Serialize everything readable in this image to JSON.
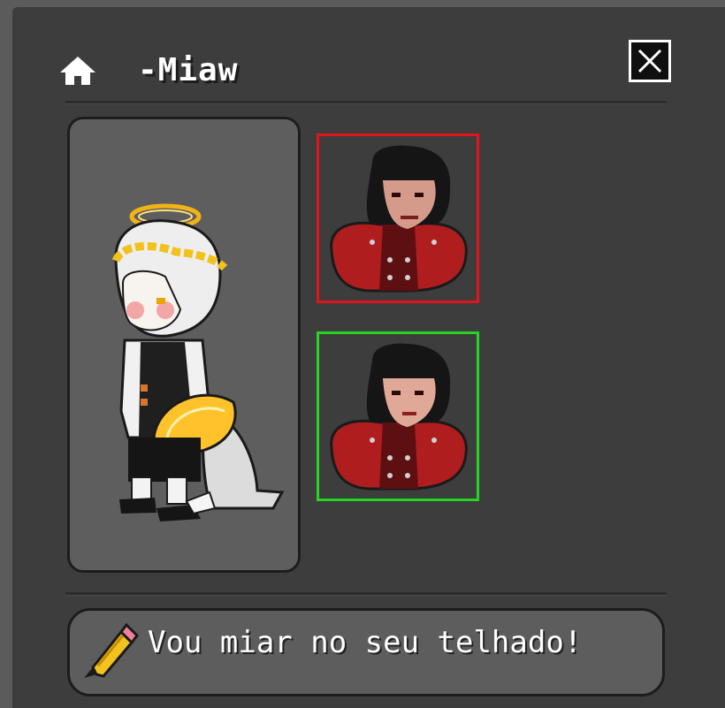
{
  "header": {
    "username": "-Miaw",
    "home_icon": "home-icon",
    "close_icon": "close-icon"
  },
  "figure": {
    "description_icon": "avatar-figure"
  },
  "looks": [
    {
      "name": "look-option-1",
      "border_color": "#e3141c",
      "state": "unselected"
    },
    {
      "name": "look-option-2",
      "border_color": "#26d421",
      "state": "selected"
    }
  ],
  "motto": {
    "text": "Vou miar no seu telhado!",
    "icon": "pencil-icon"
  },
  "colors": {
    "panel": "#3d3d3d",
    "frame": "#5b5b5b",
    "text": "#ffffff"
  }
}
